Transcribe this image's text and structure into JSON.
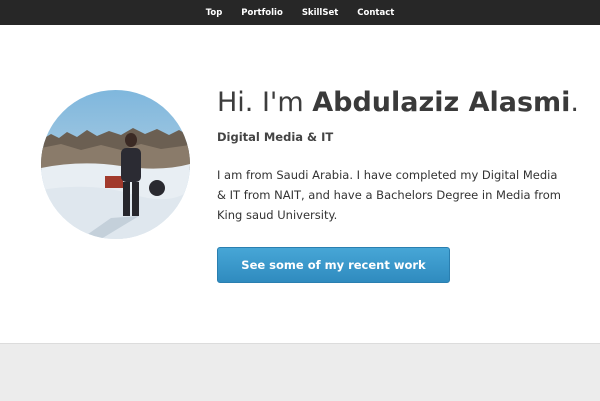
{
  "nav": {
    "items": [
      {
        "label": "Top"
      },
      {
        "label": "Portfolio"
      },
      {
        "label": "SkillSet"
      },
      {
        "label": "Contact"
      }
    ]
  },
  "hero": {
    "greeting_prefix": "Hi. I'm ",
    "name": "Abdulaziz Alasmi",
    "greeting_suffix": ".",
    "subtitle": "Digital Media & IT",
    "bio": "I am from Saudi Arabia. I have completed my Digital Media & IT from NAIT, and have a Bachelors Degree in Media from King saud University.",
    "cta_label": "See some of my recent work"
  },
  "colors": {
    "nav_bg": "#272727",
    "button": "#3a98cb",
    "footer_bg": "#ececec"
  }
}
